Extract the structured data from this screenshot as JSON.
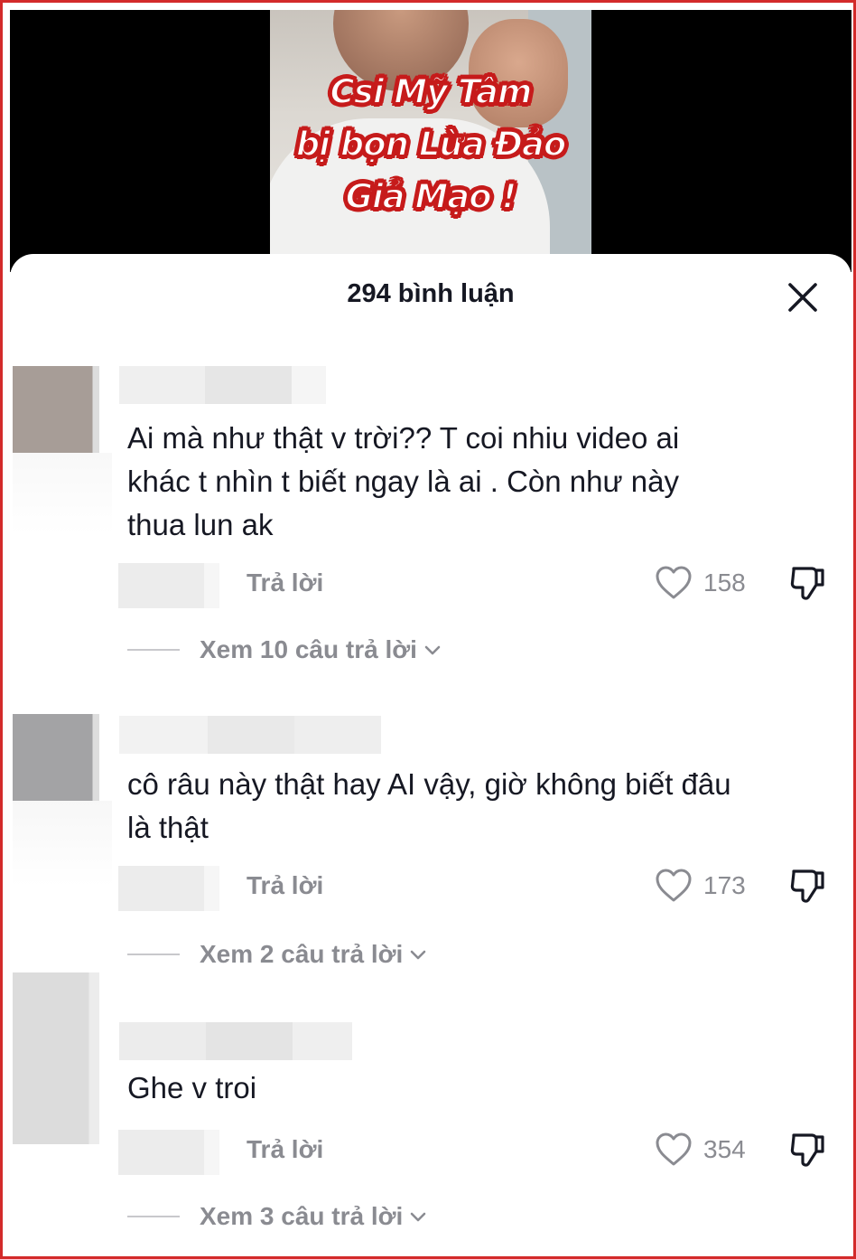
{
  "video": {
    "caption_lines": [
      "Csi Mỹ Tâm",
      "bị bọn Lừa Đảo",
      "Giả Mạo !"
    ]
  },
  "sheet": {
    "title": "294 bình luận"
  },
  "comments": [
    {
      "text_lines": [
        "Ai mà như thật v trời?? T coi nhiu video ai",
        "khác t nhìn t biết ngay là ai . Còn như này",
        "thua lun ak"
      ],
      "reply_label": "Trả lời",
      "likes": "158",
      "view_replies": "Xem 10 câu trả lời"
    },
    {
      "text_lines": [
        "cô râu này thật hay AI vậy, giờ không biết đâu",
        "là thật"
      ],
      "reply_label": "Trả lời",
      "likes": "173",
      "view_replies": "Xem 2 câu trả lời"
    },
    {
      "text_lines": [
        "Ghe v troi"
      ],
      "reply_label": "Trả lời",
      "likes": "354",
      "view_replies": "Xem 3 câu trả lời"
    }
  ],
  "icons": {
    "close": "close-icon",
    "like": "heart-icon",
    "dislike": "thumbs-down-icon",
    "expand": "chevron-down-icon"
  },
  "colors": {
    "border": "#d32a2a",
    "text": "#161823",
    "secondary": "#8a8b91"
  }
}
